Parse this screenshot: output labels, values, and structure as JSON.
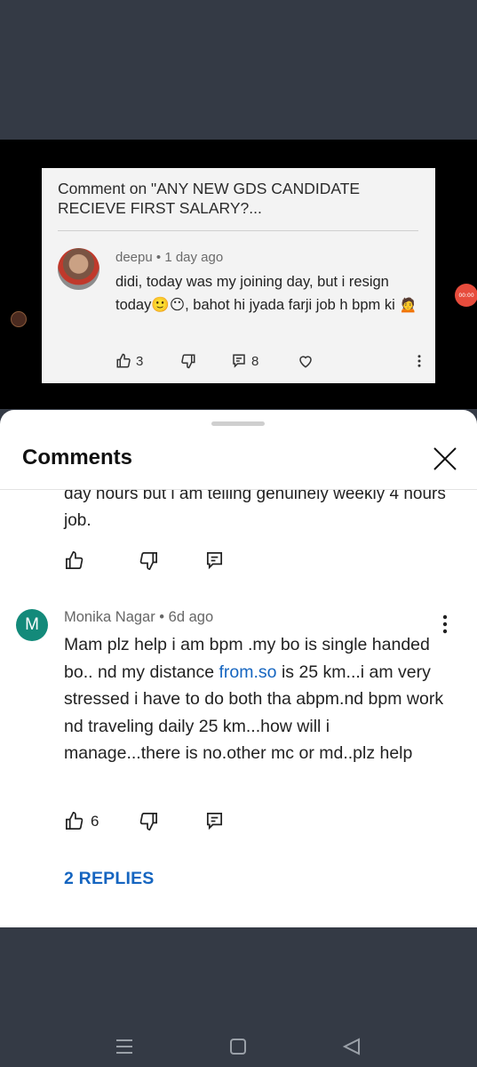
{
  "video_card": {
    "title": "Comment on \"ANY NEW GDS CANDIDATE RECIEVE FIRST SALARY?...",
    "author": "deepu",
    "time": "1 day ago",
    "text": "didi, today was my joining day, but i resign today🙂😶, bahot hi jyada farji job h bpm ki 🙍",
    "likes": "3",
    "replies_count": "8"
  },
  "player": {
    "timer_label": "00:00"
  },
  "sheet": {
    "title": "Comments",
    "partial_comment": "day hours but i am telling genuinely weekly 4 hours job.",
    "comment": {
      "avatar_letter": "M",
      "author": "Monika Nagar",
      "time": "6d ago",
      "text_part1": "Mam plz help i am bpm  .my  bo is  single handed  bo.. nd  my distance ",
      "link_text": "from.so",
      "text_part2": " is 25 km...i am very stressed  i have to  do both tha abpm.nd bpm work nd traveling daily 25 km...how will i manage...there is no.other mc or md..plz help",
      "likes": "6"
    },
    "replies_label": "2 REPLIES"
  },
  "icons": {
    "like": "thumb-up-icon",
    "dislike": "thumb-down-icon",
    "reply": "reply-icon",
    "heart": "heart-icon",
    "more": "more-vertical-icon",
    "close": "close-icon"
  },
  "colors": {
    "accent_link": "#1565c0",
    "avatar_bg": "#138a7a",
    "system_bg": "#343a45"
  }
}
